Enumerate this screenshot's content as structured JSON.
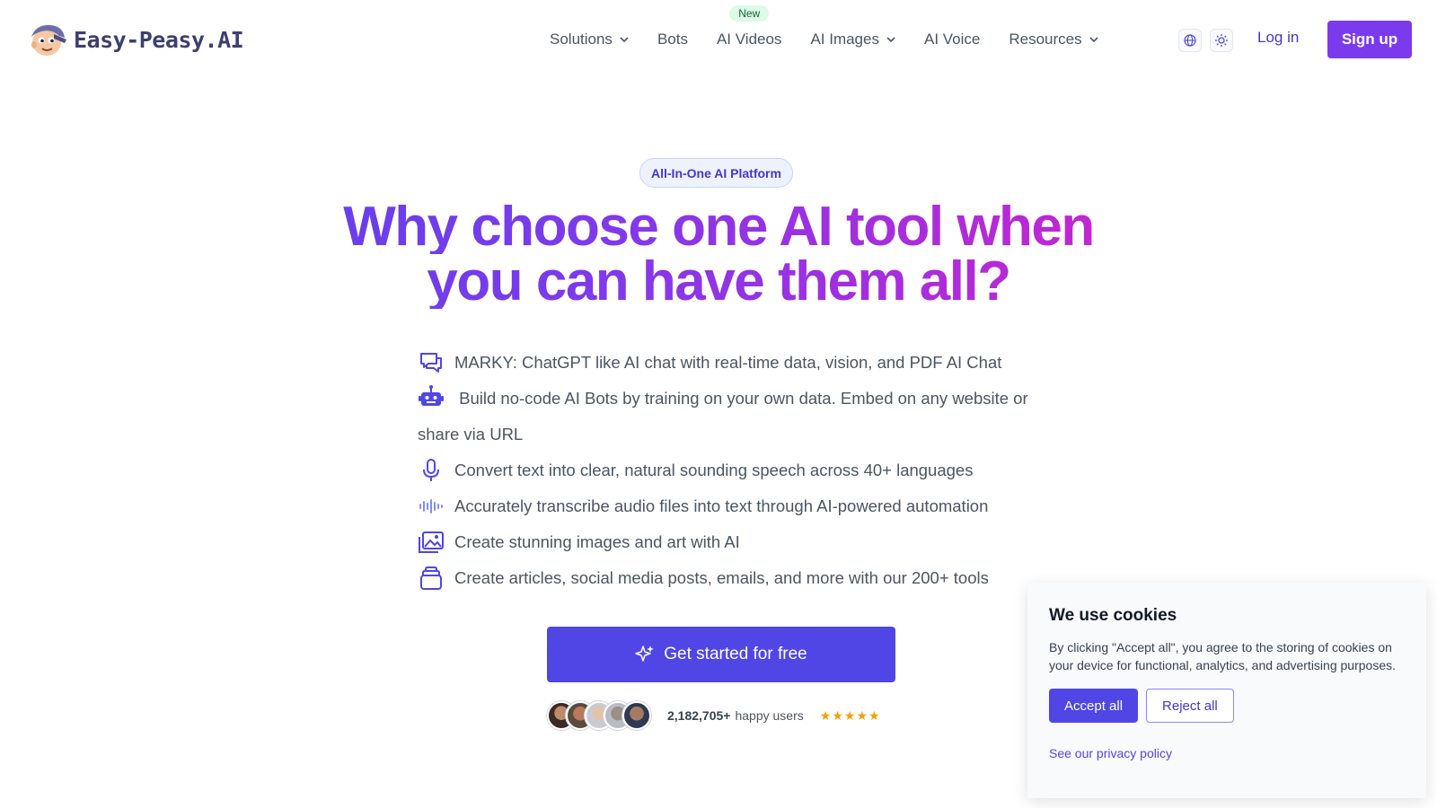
{
  "brand": {
    "name": "Easy-Peasy.AI",
    "logo_icon": "mascot-logo"
  },
  "nav": {
    "items": [
      {
        "label": "Solutions",
        "has_dropdown": true
      },
      {
        "label": "Bots",
        "has_dropdown": false
      },
      {
        "label": "AI Videos",
        "has_dropdown": false,
        "badge": "New"
      },
      {
        "label": "AI Images",
        "has_dropdown": true
      },
      {
        "label": "AI Voice",
        "has_dropdown": false
      },
      {
        "label": "Resources",
        "has_dropdown": true
      }
    ],
    "language_icon": "globe-icon",
    "theme_icon": "sun-icon",
    "login_label": "Log in",
    "signup_label": "Sign up"
  },
  "hero": {
    "badge": "All-In-One AI Platform",
    "headline_line1": "Why choose one AI tool when",
    "headline_line2": "you can have them all?",
    "features": [
      {
        "icon": "chat-bubbles-icon",
        "text": "MARKY: ChatGPT like AI chat with real-time data, vision, and PDF AI Chat"
      },
      {
        "icon": "robot-icon",
        "text": "Build no-code AI Bots by training on your own data. Embed on any website or share via URL"
      },
      {
        "icon": "microphone-icon",
        "text": "Convert text into clear, natural sounding speech across 40+ languages"
      },
      {
        "icon": "waveform-icon",
        "text": "Accurately transcribe audio files into text through AI-powered automation"
      },
      {
        "icon": "images-icon",
        "text": "Create stunning images and art with AI"
      },
      {
        "icon": "stack-icon",
        "text": "Create articles, social media posts, emails, and more with our 200+ tools"
      }
    ],
    "cta_label": "Get started for free",
    "users_count": "2,182,705+",
    "users_label": "happy users",
    "rating_stars": 5
  },
  "cookie": {
    "title": "We use cookies",
    "text": "By clicking \"Accept all\", you agree to the storing of cookies on your device for functional, analytics, and advertising purposes.",
    "accept_label": "Accept all",
    "reject_label": "Reject all",
    "privacy_label": "See our privacy policy"
  },
  "colors": {
    "primary": "#4f46e5",
    "signup": "#7c3aed",
    "gradient_start": "#4f46e5",
    "gradient_end": "#db2777",
    "star": "#f59e0b"
  }
}
